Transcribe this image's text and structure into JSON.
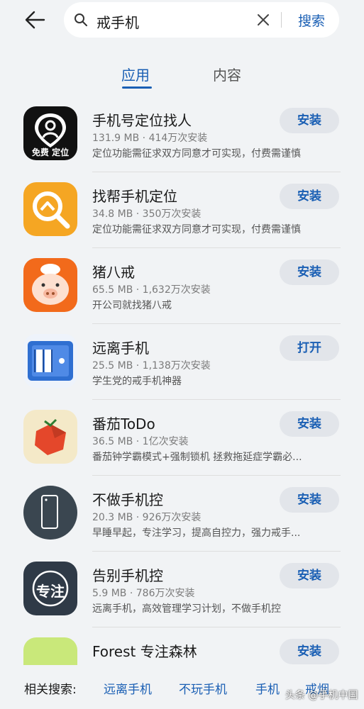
{
  "search": {
    "query": "戒手机",
    "button_label": "搜索"
  },
  "tabs": [
    {
      "label": "应用",
      "active": true
    },
    {
      "label": "内容",
      "active": false
    }
  ],
  "apps": [
    {
      "name": "手机号定位找人",
      "meta": "131.9 MB · 414万次安装",
      "desc": "定位功能需征求双方同意才可实现，付费需谨慎",
      "action": "安装",
      "icon": "location-pin-icon",
      "icon_text": "免费 定位"
    },
    {
      "name": "找帮手机定位",
      "meta": "34.8 MB · 350万次安装",
      "desc": "定位功能需征求双方同意才可实现，付费需谨慎",
      "action": "安装",
      "icon": "location-search-icon"
    },
    {
      "name": "猪八戒",
      "meta": "65.5 MB · 1,632万次安装",
      "desc": "开公司就找猪八戒",
      "action": "安装",
      "icon": "pig-icon"
    },
    {
      "name": "远离手机",
      "meta": "25.5 MB · 1,138万次安装",
      "desc": "学生党的戒手机神器",
      "action": "打开",
      "icon": "phone-jail-icon"
    },
    {
      "name": "番茄ToDo",
      "meta": "36.5 MB · 1亿次安装",
      "desc": "番茄钟学霸模式+强制锁机 拯救拖延症学霸必...",
      "action": "安装",
      "icon": "tomato-icon"
    },
    {
      "name": "不做手机控",
      "meta": "20.3 MB · 926万次安装",
      "desc": "早睡早起，专注学习，提高自控力，强力戒手...",
      "action": "安装",
      "icon": "phone-outline-icon"
    },
    {
      "name": "告别手机控",
      "meta": "5.9 MB · 786万次安装",
      "desc": "远离手机，高效管理学习计划，不做手机控",
      "action": "安装",
      "icon": "focus-icon",
      "icon_text": "专注"
    },
    {
      "name": "Forest 专注森林",
      "meta": "",
      "desc": "",
      "action": "安装",
      "icon": "forest-icon"
    }
  ],
  "related": {
    "label": "相关搜索:",
    "items": [
      "远离手机",
      "不玩手机",
      "手机",
      "戒烟"
    ]
  },
  "watermark": "头条 @手机中国",
  "colors": {
    "accent": "#1a5fb4",
    "background": "#f1f3f5"
  }
}
